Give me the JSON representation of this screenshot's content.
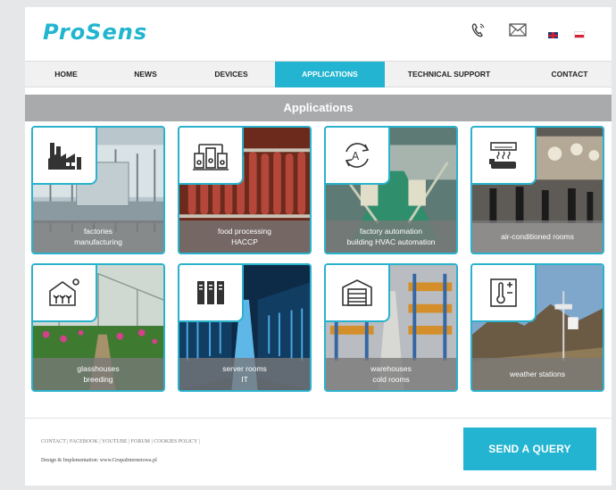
{
  "header": {
    "logo": "ProSens",
    "icons": [
      "phone-icon",
      "mail-icon",
      "flag-uk-icon",
      "flag-pl-icon"
    ]
  },
  "nav": {
    "items": [
      {
        "label": "HOME",
        "active": false
      },
      {
        "label": "NEWS",
        "active": false
      },
      {
        "label": "DEVICES",
        "active": false
      },
      {
        "label": "APPLICATIONS",
        "active": true
      },
      {
        "label": "TECHNICAL SUPPORT",
        "active": false
      },
      {
        "label": "CONTACT",
        "active": false
      }
    ]
  },
  "section": {
    "title": "Applications"
  },
  "tiles": [
    {
      "line1": "factories",
      "line2": "manufacturing",
      "icon": "factory-icon"
    },
    {
      "line1": "food processing",
      "line2": "HACCP",
      "icon": "food-processing-icon"
    },
    {
      "line1": "factory automation",
      "line2": "building HVAC automation",
      "icon": "automation-icon"
    },
    {
      "line1": "air-conditioned rooms",
      "line2": "",
      "icon": "air-conditioner-icon"
    },
    {
      "line1": "glasshouses",
      "line2": "breeding",
      "icon": "glasshouse-icon"
    },
    {
      "line1": "server rooms",
      "line2": "IT",
      "icon": "server-icon"
    },
    {
      "line1": "warehouses",
      "line2": "cold rooms",
      "icon": "warehouse-icon"
    },
    {
      "line1": "weather stations",
      "line2": "",
      "icon": "thermometer-icon"
    }
  ],
  "footer": {
    "links": "CONTACT | FACEBOOK | YOUTUBE | FORUM | COOKIES POLICY |",
    "credit": "Design & Implementation: www.GrupaInternetowa.pl",
    "button": "SEND A QUERY"
  },
  "colors": {
    "accent": "#23b4d1",
    "section_bar": "#a9aaac"
  }
}
